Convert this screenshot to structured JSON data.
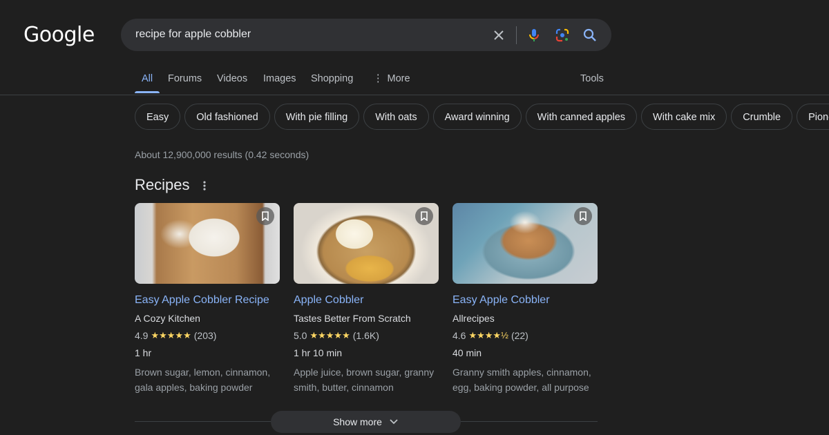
{
  "logo": "Google",
  "search": {
    "query": "recipe for apple cobbler",
    "icons": [
      "clear-icon",
      "microphone-icon",
      "google-lens-icon",
      "search-icon"
    ]
  },
  "tabs": [
    {
      "label": "All",
      "active": true
    },
    {
      "label": "Forums"
    },
    {
      "label": "Videos"
    },
    {
      "label": "Images"
    },
    {
      "label": "Shopping"
    },
    {
      "label": "More",
      "icon": "more-vert-icon"
    }
  ],
  "tools_label": "Tools",
  "chips": [
    "Easy",
    "Old fashioned",
    "With pie filling",
    "With oats",
    "Award winning",
    "With canned apples",
    "With cake mix",
    "Crumble",
    "Pioneer woman"
  ],
  "result_stats": "About 12,900,000 results (0.42 seconds)",
  "recipes": {
    "title": "Recipes",
    "cards": [
      {
        "title": "Easy Apple Cobbler Recipe",
        "source": "A Cozy Kitchen",
        "rating": "4.9",
        "stars": "★★★★★",
        "reviews": "(203)",
        "time": "1 hr",
        "ingredients": "Brown sugar, lemon, cinnamon, gala apples, baking powder"
      },
      {
        "title": "Apple Cobbler",
        "source": "Tastes Better From Scratch",
        "rating": "5.0",
        "stars": "★★★★★",
        "reviews": "(1.6K)",
        "time": "1 hr 10 min",
        "ingredients": "Apple juice, brown sugar, granny smith, butter, cinnamon"
      },
      {
        "title": "Easy Apple Cobbler",
        "source": "Allrecipes",
        "rating": "4.6",
        "stars": "★★★★½",
        "reviews": "(22)",
        "time": "40 min",
        "ingredients": "Granny smith apples, cinnamon, egg, baking powder, all purpose"
      }
    ]
  },
  "show_more": "Show more",
  "colors": {
    "background": "#1f1f1f",
    "link": "#8ab4f8",
    "star": "#fdd663",
    "searchbox": "#303134"
  }
}
